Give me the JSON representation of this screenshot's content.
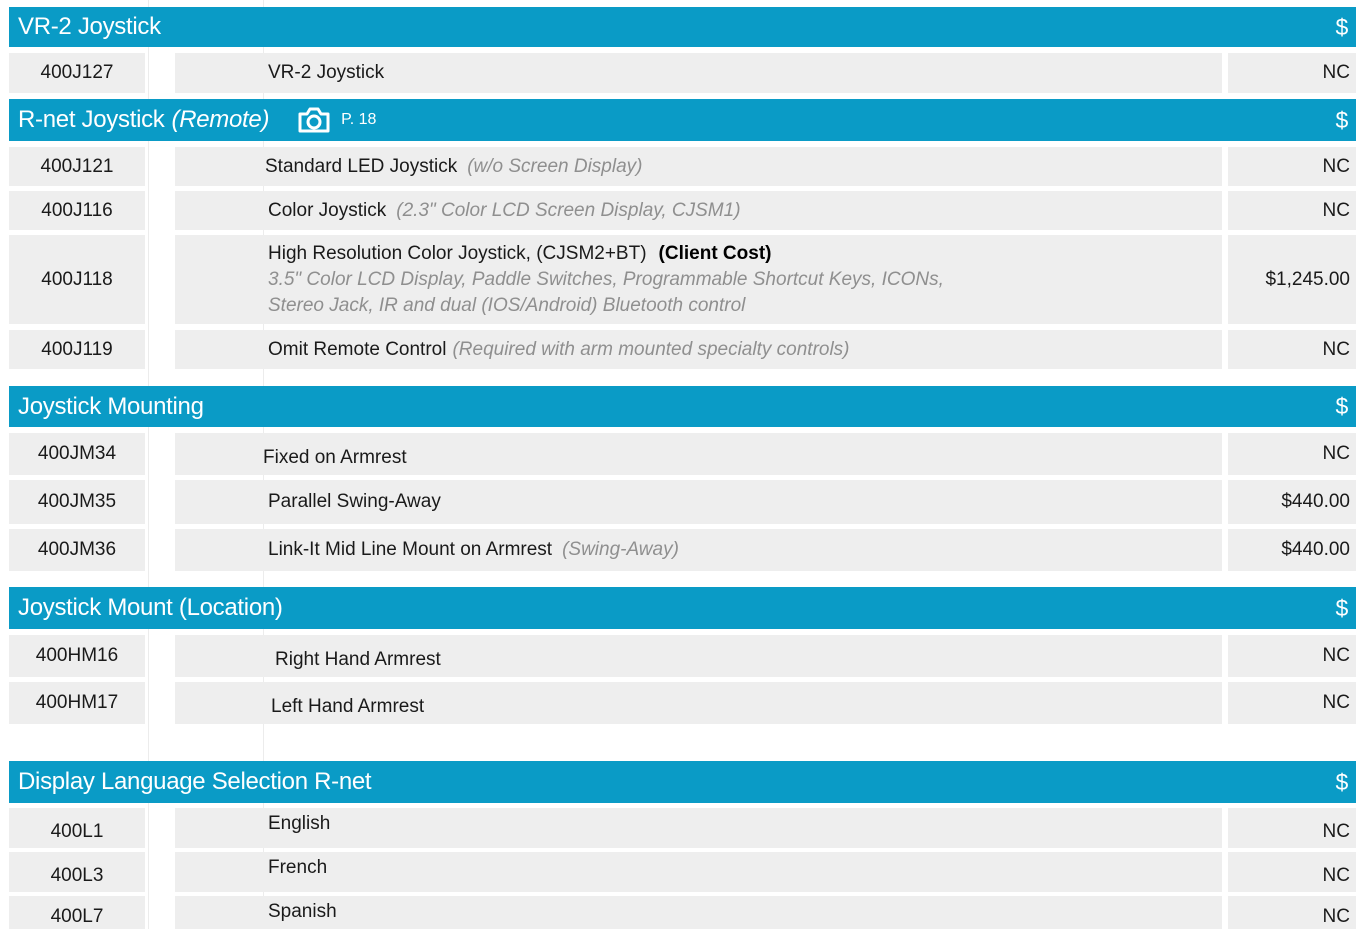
{
  "sections": {
    "vr2": {
      "title": "VR-2 Joystick",
      "currency": "$",
      "rows": [
        {
          "code": "400J127",
          "desc": "VR-2 Joystick",
          "price": "NC"
        }
      ]
    },
    "rnet": {
      "title": "R-net Joystick",
      "title_note": "(Remote)",
      "page_ref": "P. 18",
      "camera_icon": "camera-icon",
      "currency": "$",
      "rows": [
        {
          "code": "400J121",
          "desc": "Standard LED Joystick",
          "note": "(w/o Screen Display)",
          "price": "NC"
        },
        {
          "code": "400J116",
          "desc": "Color Joystick",
          "note": "(2.3\" Color LCD Screen Display, CJSM1)",
          "price": "NC"
        },
        {
          "code": "400J118",
          "desc": "High Resolution Color Joystick, (CJSM2+BT)",
          "highlight": "(Client Cost)",
          "note_line1": "3.5\" Color LCD Display, Paddle Switches, Programmable Shortcut Keys, ICONs,",
          "note_line2": "Stereo Jack, IR and dual (IOS/Android) Bluetooth control",
          "price": "$1,245.00"
        },
        {
          "code": "400J119",
          "desc": "Omit Remote Control",
          "note": "(Required with arm mounted specialty controls)",
          "price": "NC"
        }
      ]
    },
    "mounting": {
      "title": "Joystick Mounting",
      "currency": "$",
      "rows": [
        {
          "code": "400JM34",
          "desc": "Fixed on Armrest",
          "price": "NC"
        },
        {
          "code": "400JM35",
          "desc": "Parallel Swing-Away",
          "price": "$440.00"
        },
        {
          "code": "400JM36",
          "desc": "Link-It Mid Line Mount on Armrest",
          "note": "(Swing-Away)",
          "price": "$440.00"
        }
      ]
    },
    "location": {
      "title": "Joystick Mount (Location)",
      "currency": "$",
      "rows": [
        {
          "code": "400HM16",
          "desc": "Right Hand Armrest",
          "price": "NC"
        },
        {
          "code": "400HM17",
          "desc": "Left Hand Armrest",
          "price": "NC"
        }
      ]
    },
    "language": {
      "title": "Display Language Selection R-net",
      "currency": "$",
      "rows": [
        {
          "code": "400L1",
          "desc": "English",
          "price": "NC"
        },
        {
          "code": "400L3",
          "desc": "French",
          "price": "NC"
        },
        {
          "code": "400L7",
          "desc": "Spanish",
          "price": "NC"
        }
      ]
    }
  },
  "colors": {
    "header_bg": "#0a9bc6",
    "row_bg": "#eeeeee",
    "note": "#8f8f8f"
  }
}
